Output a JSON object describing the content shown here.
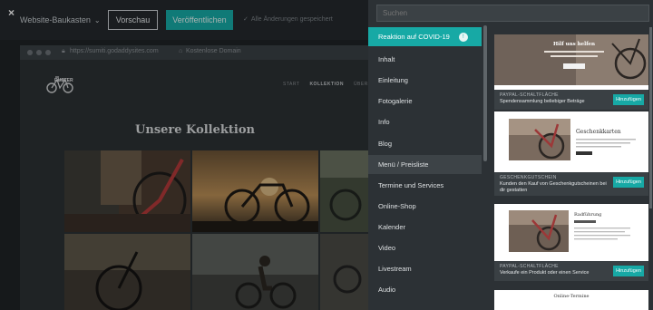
{
  "topbar": {
    "close_label": "×",
    "site_menu": "Website-Baukasten",
    "site_menu_icon": "chevron-down-icon",
    "preview_label": "Vorschau",
    "publish_label": "Veröffentlichen",
    "saved_status": "Alle Änderungen gespeichert",
    "saved_icon": "check-icon"
  },
  "browser": {
    "url": "https://sumiti.godaddysites.com",
    "domain_link": "Kostenlose Domain",
    "lock_icon": "lock-icon"
  },
  "site": {
    "logo_text": "RUSTER",
    "nav": [
      "START",
      "KOLLEKTION",
      "ÜBER"
    ],
    "nav_active": "KOLLEKTION",
    "title": "Unsere Kollektion"
  },
  "panel": {
    "search_placeholder": "Suchen",
    "categories": [
      {
        "label": "Reaktion auf COVID-19",
        "active": true,
        "badge_icon": "alert-icon"
      },
      {
        "label": "Inhalt"
      },
      {
        "label": "Einleitung"
      },
      {
        "label": "Fotogalerie"
      },
      {
        "label": "Info"
      },
      {
        "label": "Blog"
      },
      {
        "label": "Menü / Preisliste",
        "hover": true
      },
      {
        "label": "Termine und Services"
      },
      {
        "label": "Online-Shop"
      },
      {
        "label": "Kalender"
      },
      {
        "label": "Video"
      },
      {
        "label": "Livestream"
      },
      {
        "label": "Audio"
      }
    ],
    "cards": [
      {
        "kind": "PAYPAL-SCHALTFLÄCHE",
        "desc": "Spendensammlung beliebiger Beträge",
        "add_label": "Hinzufügen",
        "thumb_title": "Hilf uns helfen"
      },
      {
        "kind": "GESCHENKGUTSCHEIN",
        "desc": "Kunden den Kauf von Geschenkgutscheinen bei dir gestatten",
        "add_label": "Hinzufügen",
        "thumb_title": "Geschenkkarten"
      },
      {
        "kind": "PAYPAL-SCHALTFLÄCHE",
        "desc": "Verkaufe ein Produkt oder einen Service",
        "add_label": "Hinzufügen",
        "thumb_title": "Radführung"
      },
      {
        "thumb_title": "Online-Termine"
      }
    ]
  },
  "colors": {
    "accent": "#17a9a5",
    "panel_bg": "#2c3135",
    "canvas_bg": "#1f2326"
  }
}
